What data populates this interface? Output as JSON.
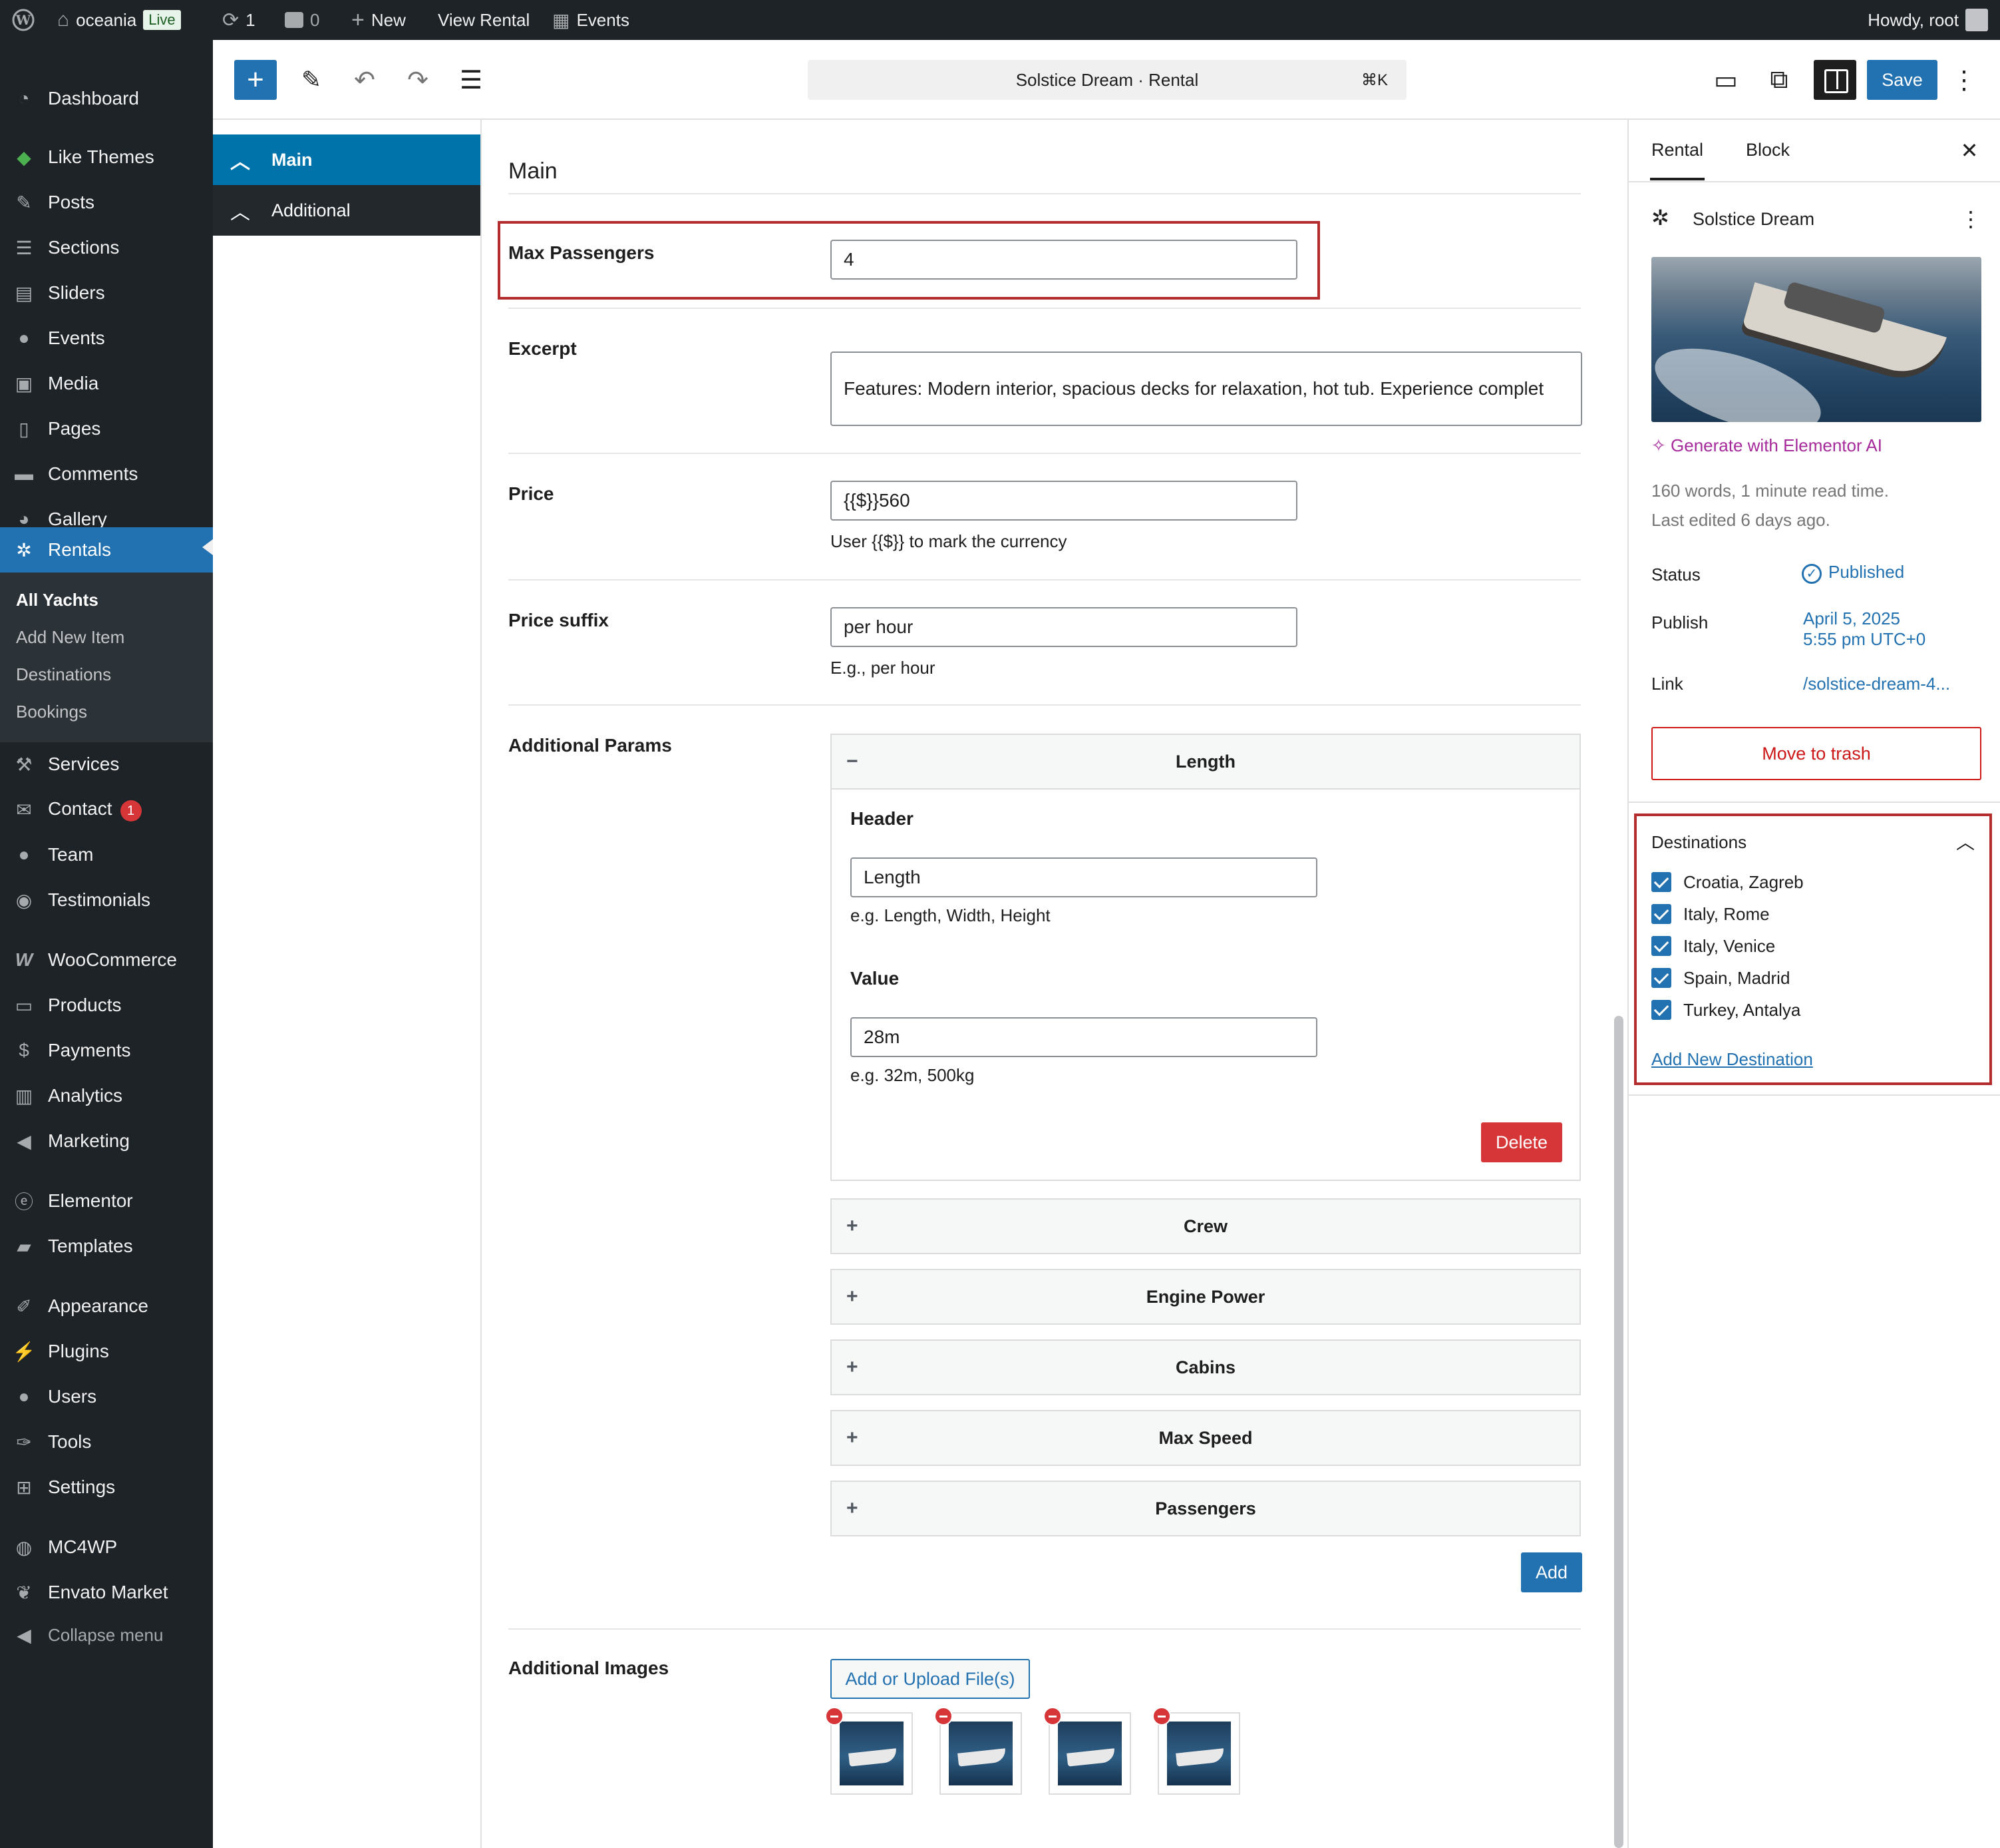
{
  "adminbar": {
    "site_name": "oceania",
    "live_badge": "Live",
    "updates_count": "1",
    "comments_count": "0",
    "new_label": "New",
    "view_label": "View Rental",
    "events_label": "Events",
    "howdy": "Howdy, root"
  },
  "menu": {
    "dashboard": "Dashboard",
    "like_themes": "Like Themes",
    "posts": "Posts",
    "sections": "Sections",
    "sliders": "Sliders",
    "events": "Events",
    "media": "Media",
    "pages": "Pages",
    "comments": "Comments",
    "gallery": "Gallery",
    "rentals": "Rentals",
    "sub_all_yachts": "All Yachts",
    "sub_add_new": "Add New Item",
    "sub_destinations": "Destinations",
    "sub_bookings": "Bookings",
    "services": "Services",
    "contact": "Contact",
    "contact_badge": "1",
    "team": "Team",
    "testimonials": "Testimonials",
    "woocommerce": "WooCommerce",
    "products": "Products",
    "payments": "Payments",
    "analytics": "Analytics",
    "marketing": "Marketing",
    "elementor": "Elementor",
    "templates": "Templates",
    "appearance": "Appearance",
    "plugins": "Plugins",
    "users": "Users",
    "tools": "Tools",
    "settings": "Settings",
    "mc4wp": "MC4WP",
    "envato": "Envato Market",
    "collapse": "Collapse menu"
  },
  "header": {
    "doc_title": "Solstice Dream · Rental",
    "shortcut": "⌘K",
    "save_label": "Save"
  },
  "metabox": {
    "nav_main": "Main",
    "nav_additional": "Additional",
    "section_title": "Main",
    "max_passengers_label": "Max Passengers",
    "max_passengers_value": "4",
    "excerpt_label": "Excerpt",
    "excerpt_value": "Features: Modern interior, spacious decks for relaxation, hot tub. Experience complet",
    "price_label": "Price",
    "price_value": "{{$}}560",
    "price_hint": "User {{$}} to mark the currency",
    "price_suffix_label": "Price suffix",
    "price_suffix_value": "per hour",
    "price_suffix_hint": "E.g., per hour",
    "additional_params_label": "Additional Params",
    "params_open_title": "Length",
    "header_label": "Header",
    "header_value": "Length",
    "header_hint": "e.g. Length, Width, Height",
    "value_label": "Value",
    "value_value": "28m",
    "value_hint": "e.g. 32m, 500kg",
    "delete_label": "Delete",
    "params_collapsed": [
      "Crew",
      "Engine Power",
      "Cabins",
      "Max Speed",
      "Passengers"
    ],
    "add_label": "Add",
    "additional_images_label": "Additional Images",
    "upload_label": "Add or Upload File(s)"
  },
  "sidebar": {
    "tab_rental": "Rental",
    "tab_block": "Block",
    "post_title": "Solstice Dream",
    "generate_ai": "Generate with Elementor AI",
    "word_count": "160 words, 1 minute read time.",
    "last_edited": "Last edited 6 days ago.",
    "status_label": "Status",
    "status_value": "Published",
    "publish_label": "Publish",
    "publish_date": "April 5, 2025",
    "publish_time": "5:55 pm UTC+0",
    "link_label": "Link",
    "link_value": "/solstice-dream-4...",
    "trash_label": "Move to trash",
    "destinations_title": "Destinations",
    "destinations": [
      "Croatia, Zagreb",
      "Italy, Rome",
      "Italy, Venice",
      "Spain, Madrid",
      "Turkey, Antalya"
    ],
    "add_destination": "Add New Destination"
  }
}
